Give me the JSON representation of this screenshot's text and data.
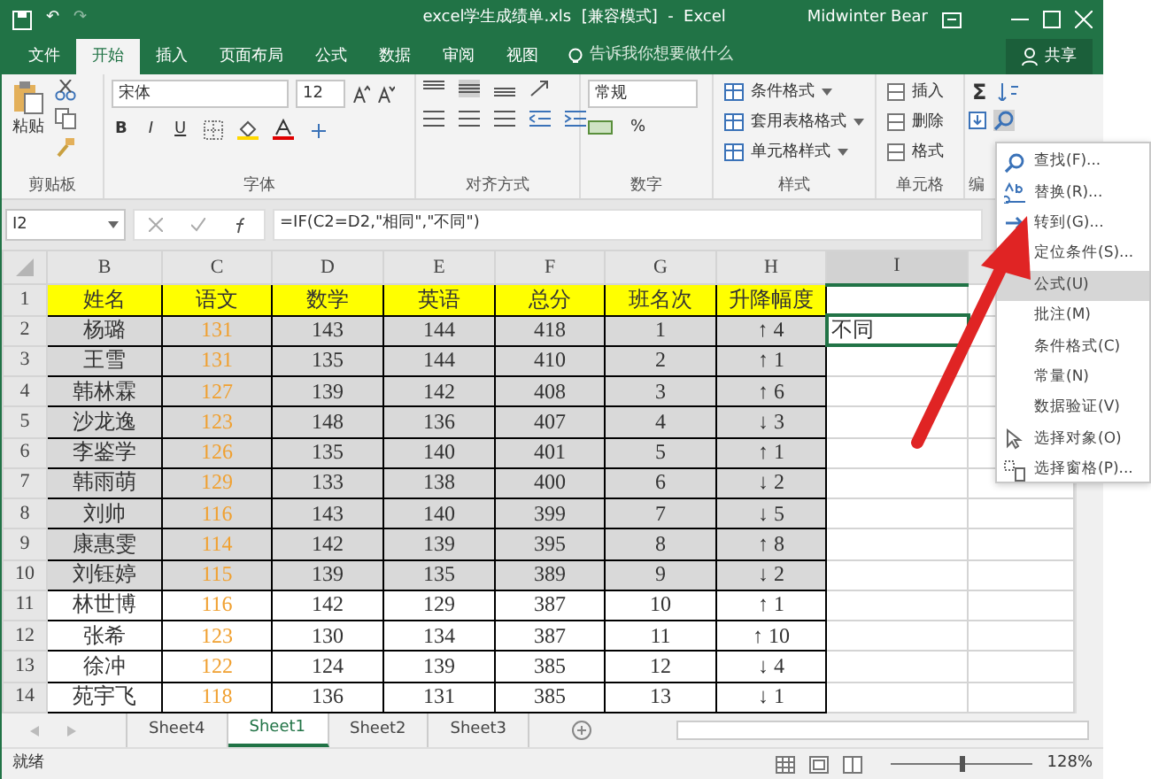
{
  "window": {
    "title": "excel学生成绩单.xls  [兼容模式]  -  Excel",
    "user": "Midwinter Bear"
  },
  "quick_access": {
    "undo": "↶",
    "redo": "↷"
  },
  "tabs": [
    {
      "label": "文件",
      "selected": false
    },
    {
      "label": "开始",
      "selected": true
    },
    {
      "label": "插入",
      "selected": false
    },
    {
      "label": "页面布局",
      "selected": false
    },
    {
      "label": "公式",
      "selected": false
    },
    {
      "label": "数据",
      "selected": false
    },
    {
      "label": "审阅",
      "selected": false
    },
    {
      "label": "视图",
      "selected": false
    }
  ],
  "tell_me": {
    "placeholder": "告诉我你想要做什么"
  },
  "share": "共享",
  "ribbon": {
    "clipboard": {
      "paste": "粘贴",
      "label": "剪贴板"
    },
    "font": {
      "name": "宋体",
      "size": "12",
      "bold": "B",
      "italic": "I",
      "underline": "U",
      "label": "字体"
    },
    "alignment": {
      "label": "对齐方式"
    },
    "number": {
      "format": "常规",
      "percent": "%",
      "label": "数字"
    },
    "styles": {
      "items": [
        "条件格式",
        "套用表格格式",
        "单元格样式"
      ],
      "label": "样式"
    },
    "cells": {
      "items": [
        "插入",
        "删除",
        "格式"
      ],
      "label": "单元格"
    },
    "editing": {
      "sum": "Σ",
      "label": "编"
    }
  },
  "formula_bar": {
    "name_box": "I2",
    "formula": "=IF(C2=D2,\"相同\",\"不同\")"
  },
  "sheet": {
    "columns": [
      {
        "label": "B",
        "selected": false
      },
      {
        "label": "C",
        "selected": false
      },
      {
        "label": "D",
        "selected": false
      },
      {
        "label": "E",
        "selected": false
      },
      {
        "label": "F",
        "selected": false
      },
      {
        "label": "G",
        "selected": false
      },
      {
        "label": "H",
        "selected": false
      },
      {
        "label": "I",
        "selected": true
      }
    ],
    "header_row": {
      "number": "1",
      "cells": [
        "姓名",
        "语文",
        "数学",
        "英语",
        "总分",
        "班名次",
        "升降幅度"
      ]
    },
    "rows": [
      {
        "number": "2",
        "shaded": true,
        "cells": [
          "杨璐",
          "131",
          "143",
          "144",
          "418",
          "1",
          "↑ 4"
        ],
        "column_i": "不同",
        "active": true
      },
      {
        "number": "3",
        "shaded": true,
        "cells": [
          "王雪",
          "131",
          "135",
          "144",
          "410",
          "2",
          "↑ 1"
        ],
        "active": false
      },
      {
        "number": "4",
        "shaded": true,
        "cells": [
          "韩林霖",
          "127",
          "139",
          "142",
          "408",
          "3",
          "↑ 6"
        ],
        "active": false
      },
      {
        "number": "5",
        "shaded": true,
        "cells": [
          "沙龙逸",
          "123",
          "148",
          "136",
          "407",
          "4",
          "↓ 3"
        ],
        "active": false
      },
      {
        "number": "6",
        "shaded": true,
        "cells": [
          "李鉴学",
          "126",
          "135",
          "140",
          "401",
          "5",
          "↑ 1"
        ],
        "active": false
      },
      {
        "number": "7",
        "shaded": true,
        "cells": [
          "韩雨萌",
          "129",
          "133",
          "138",
          "400",
          "6",
          "↓ 2"
        ],
        "active": false
      },
      {
        "number": "8",
        "shaded": true,
        "cells": [
          "刘帅",
          "116",
          "143",
          "140",
          "399",
          "7",
          "↓ 5"
        ],
        "active": false
      },
      {
        "number": "9",
        "shaded": true,
        "cells": [
          "康惠雯",
          "114",
          "142",
          "139",
          "395",
          "8",
          "↑ 8"
        ],
        "active": false
      },
      {
        "number": "10",
        "shaded": true,
        "cells": [
          "刘钰婷",
          "115",
          "139",
          "135",
          "389",
          "9",
          "↓ 2"
        ],
        "active": false
      },
      {
        "number": "11",
        "shaded": false,
        "cells": [
          "林世博",
          "116",
          "142",
          "129",
          "387",
          "10",
          "↑ 1"
        ],
        "active": false
      },
      {
        "number": "12",
        "shaded": false,
        "cells": [
          "张希",
          "123",
          "130",
          "134",
          "387",
          "11",
          "↑ 10"
        ],
        "active": false
      },
      {
        "number": "13",
        "shaded": false,
        "cells": [
          "徐冲",
          "122",
          "124",
          "139",
          "385",
          "12",
          "↓ 4"
        ],
        "active": false
      },
      {
        "number": "14",
        "shaded": false,
        "cells": [
          "苑宇飞",
          "118",
          "136",
          "131",
          "385",
          "13",
          "↓ 1"
        ],
        "active": false
      }
    ]
  },
  "sheet_tabs": [
    {
      "label": "Sheet4",
      "selected": false
    },
    {
      "label": "Sheet1",
      "selected": true
    },
    {
      "label": "Sheet2",
      "selected": false
    },
    {
      "label": "Sheet3",
      "selected": false
    }
  ],
  "status_bar": {
    "text": "就绪",
    "zoom": "128%",
    "zoom_slider": {
      "level": 0.5
    }
  },
  "find_menu": {
    "items": [
      {
        "kind": "find",
        "label": "查找(F)...",
        "selected": false
      },
      {
        "kind": "replace",
        "label": "替换(R)...",
        "selected": false
      },
      {
        "kind": "goto",
        "label": "转到(G)...",
        "selected": false
      },
      {
        "kind": "plain",
        "label": "定位条件(S)...",
        "selected": false
      },
      {
        "kind": "plain",
        "label": "公式(U)",
        "selected": true
      },
      {
        "kind": "plain",
        "label": "批注(M)",
        "selected": false
      },
      {
        "kind": "plain",
        "label": "条件格式(C)",
        "selected": false
      },
      {
        "kind": "plain",
        "label": "常量(N)",
        "selected": false
      },
      {
        "kind": "plain",
        "label": "数据验证(V)",
        "selected": false
      },
      {
        "kind": "pointer",
        "label": "选择对象(O)",
        "selected": false
      },
      {
        "kind": "pane",
        "label": "选择窗格(P)...",
        "selected": false
      }
    ]
  }
}
